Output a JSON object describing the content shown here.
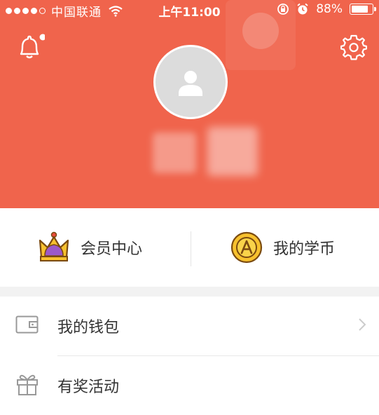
{
  "status_bar": {
    "carrier": "中国联通",
    "time": "上午11:00",
    "battery": "88%",
    "battery_level": 0.88
  },
  "header": {
    "background_color": "#f0644c",
    "notification_icon": "bell-icon",
    "settings_icon": "gear-icon",
    "avatar_icon": "user-avatar-icon"
  },
  "membership": {
    "left": {
      "label": "会员中心",
      "icon": "crown-icon"
    },
    "right": {
      "label": "我的学币",
      "icon": "coin-a-icon"
    }
  },
  "menu": {
    "items": [
      {
        "label": "我的钱包",
        "icon": "wallet-icon",
        "has_chevron": true
      },
      {
        "label": "有奖活动",
        "icon": "gift-icon",
        "has_chevron": false
      }
    ]
  }
}
